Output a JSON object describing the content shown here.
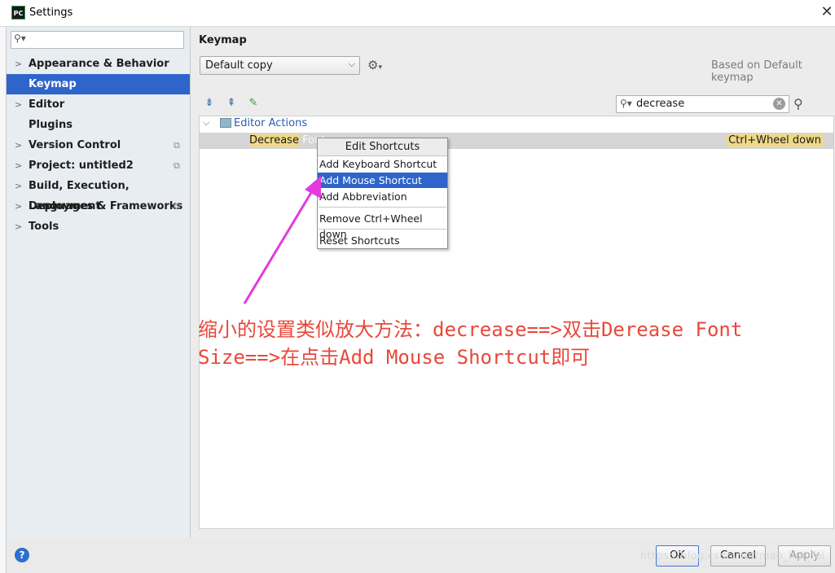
{
  "window": {
    "title": "Settings",
    "app_icon_text": "PC",
    "close_glyph": "✕"
  },
  "sidebar": {
    "search_placeholder": "",
    "items": [
      {
        "label": "Appearance & Behavior",
        "expandable": true
      },
      {
        "label": "Keymap",
        "selected": true
      },
      {
        "label": "Editor",
        "expandable": true
      },
      {
        "label": "Plugins"
      },
      {
        "label": "Version Control",
        "expandable": true,
        "project": true
      },
      {
        "label": "Project: untitled2",
        "expandable": true,
        "project": true
      },
      {
        "label": "Build, Execution, Deployment",
        "expandable": true
      },
      {
        "label": "Languages & Frameworks",
        "expandable": true,
        "project": true
      },
      {
        "label": "Tools",
        "expandable": true
      }
    ]
  },
  "main": {
    "title": "Keymap",
    "keymap_select": "Default copy",
    "based_on": "Based on Default keymap",
    "search_value": "decrease",
    "tree": {
      "group_label": "Editor Actions",
      "action_highlight": "Decrease",
      "action_rest": " Font",
      "shortcut": "Ctrl+Wheel down"
    }
  },
  "context_menu": {
    "header": "Edit Shortcuts",
    "items": [
      "Add Keyboard Shortcut",
      "Add Mouse Shortcut",
      "Add Abbreviation",
      "Remove Ctrl+Wheel down",
      "Reset Shortcuts"
    ],
    "selected_index": 1
  },
  "annotation": {
    "line1": "缩小的设置类似放大方法：decrease==>双击Derease Font",
    "line2": "Size==>在点击Add Mouse Shortcut即可",
    "color": "#e8483a"
  },
  "footer": {
    "help": "?",
    "ok": "OK",
    "cancel": "Cancel",
    "apply": "Apply",
    "watermark": "https://blog.csdn.net/mao_hui_fei"
  },
  "colors": {
    "selection": "#2f65ca",
    "highlight": "#efd984",
    "arrow": "#e23ae0"
  }
}
